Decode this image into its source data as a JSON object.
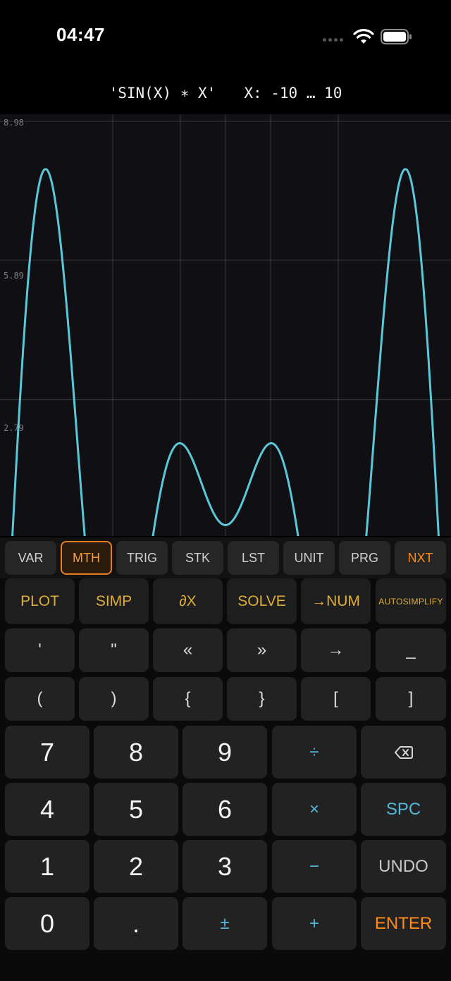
{
  "status": {
    "time": "04:47"
  },
  "header": {
    "expression": "'SIN(X) ∗ X'",
    "range": "X: -10 … 10"
  },
  "plot": {
    "y_labels": [
      "8.98",
      "5.89",
      "2.79"
    ],
    "curve_color": "#5bc8d9",
    "background": "#0f0f14",
    "grid_color": "#3a3a3a"
  },
  "chart_data": {
    "type": "line",
    "title": "",
    "function": "SIN(X) ∗ X",
    "xlim": [
      -10,
      10
    ],
    "ylim": [
      -0.4,
      8.98
    ],
    "y_ticks": [
      8.98,
      5.89,
      2.79
    ],
    "grid": true,
    "series": [
      {
        "function": "sin(x)*x",
        "color": "#5bc8d9"
      }
    ]
  },
  "menu": {
    "tabs": [
      {
        "label": "VAR"
      },
      {
        "label": "MTH"
      },
      {
        "label": "TRIG"
      },
      {
        "label": "STK"
      },
      {
        "label": "LST"
      },
      {
        "label": "UNIT"
      },
      {
        "label": "PRG"
      },
      {
        "label": "NXT"
      }
    ],
    "active": "MTH"
  },
  "keys": {
    "soft": [
      "PLOT",
      "SIMP",
      "∂X",
      "SOLVE",
      "→NUM",
      "AUTOSIMPLIFY"
    ],
    "row_quotes": [
      "'",
      "\"",
      "«",
      "»",
      "→",
      "_"
    ],
    "row_brackets": [
      "(",
      ")",
      "{",
      "}",
      "[",
      "]"
    ],
    "row1": [
      "7",
      "8",
      "9",
      "÷"
    ],
    "row2": [
      "4",
      "5",
      "6",
      "×",
      "SPC"
    ],
    "row3": [
      "1",
      "2",
      "3",
      "−",
      "UNDO"
    ],
    "row4": [
      "0",
      ".",
      "±",
      "+",
      "ENTER"
    ],
    "backspace_icon": "backspace-icon"
  }
}
